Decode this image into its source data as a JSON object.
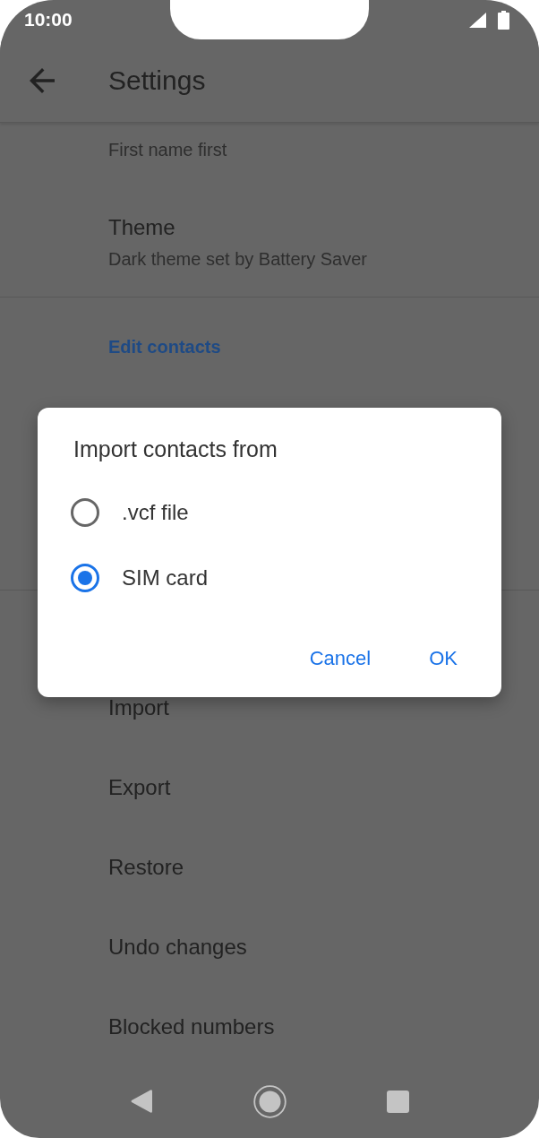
{
  "status_bar": {
    "time": "10:00"
  },
  "app_bar": {
    "title": "Settings"
  },
  "sections": [
    {
      "items": [
        {
          "subtitle": "First name first"
        },
        {
          "title": "Theme",
          "subtitle": "Dark theme set by Battery Saver"
        }
      ]
    },
    {
      "header": "Edit contacts"
    },
    {
      "items": [
        {
          "title": "Import"
        },
        {
          "title": "Export"
        },
        {
          "title": "Restore"
        },
        {
          "title": "Undo changes"
        },
        {
          "title": "Blocked numbers"
        }
      ]
    }
  ],
  "dialog": {
    "title": "Import contacts from",
    "options": [
      {
        "label": ".vcf file",
        "selected": false
      },
      {
        "label": "SIM card",
        "selected": true
      }
    ],
    "buttons": [
      "Cancel",
      "OK"
    ]
  }
}
